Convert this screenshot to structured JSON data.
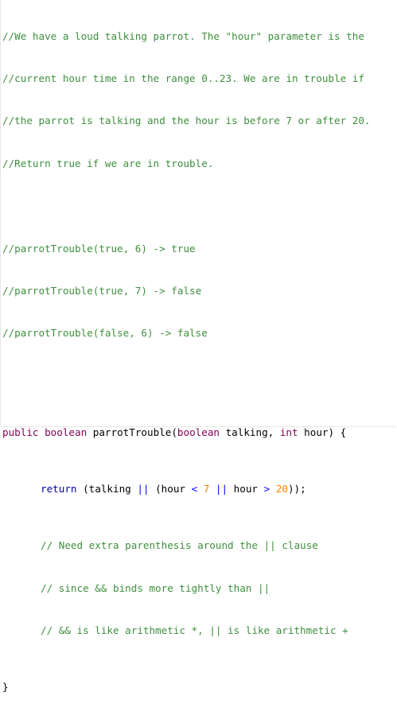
{
  "comments_header": [
    "//We have a loud talking parrot. The \"hour\" parameter is the",
    "//current hour time in the range 0..23. We are in trouble if",
    "//the parrot is talking and the hour is before 7 or after 20.",
    "//Return true if we are in trouble."
  ],
  "examples": [
    "//parrotTrouble(true, 6) -> true",
    "//parrotTrouble(true, 7) -> false",
    "//parrotTrouble(false, 6) -> false"
  ],
  "signature": {
    "kw_public": "public",
    "kw_boolean": "boolean",
    "method": "parrotTrouble(",
    "param_type1": "boolean",
    "param1": " talking, ",
    "param_type2": "int",
    "param2": " hour) {"
  },
  "body": {
    "kw_return": "return",
    "p1": " (talking ",
    "or1": "||",
    "p2": " (hour ",
    "lt": "<",
    "n7": " 7 ",
    "or2": "||",
    "p3": " hour ",
    "gt": ">",
    "n20": " 20",
    "end": "));"
  },
  "body_comments": [
    "// Need extra parenthesis around the || clause",
    "// since && binds more tightly than ||",
    "// && is like arithmetic *, || is like arithmetic +"
  ],
  "closing_brace": "}"
}
